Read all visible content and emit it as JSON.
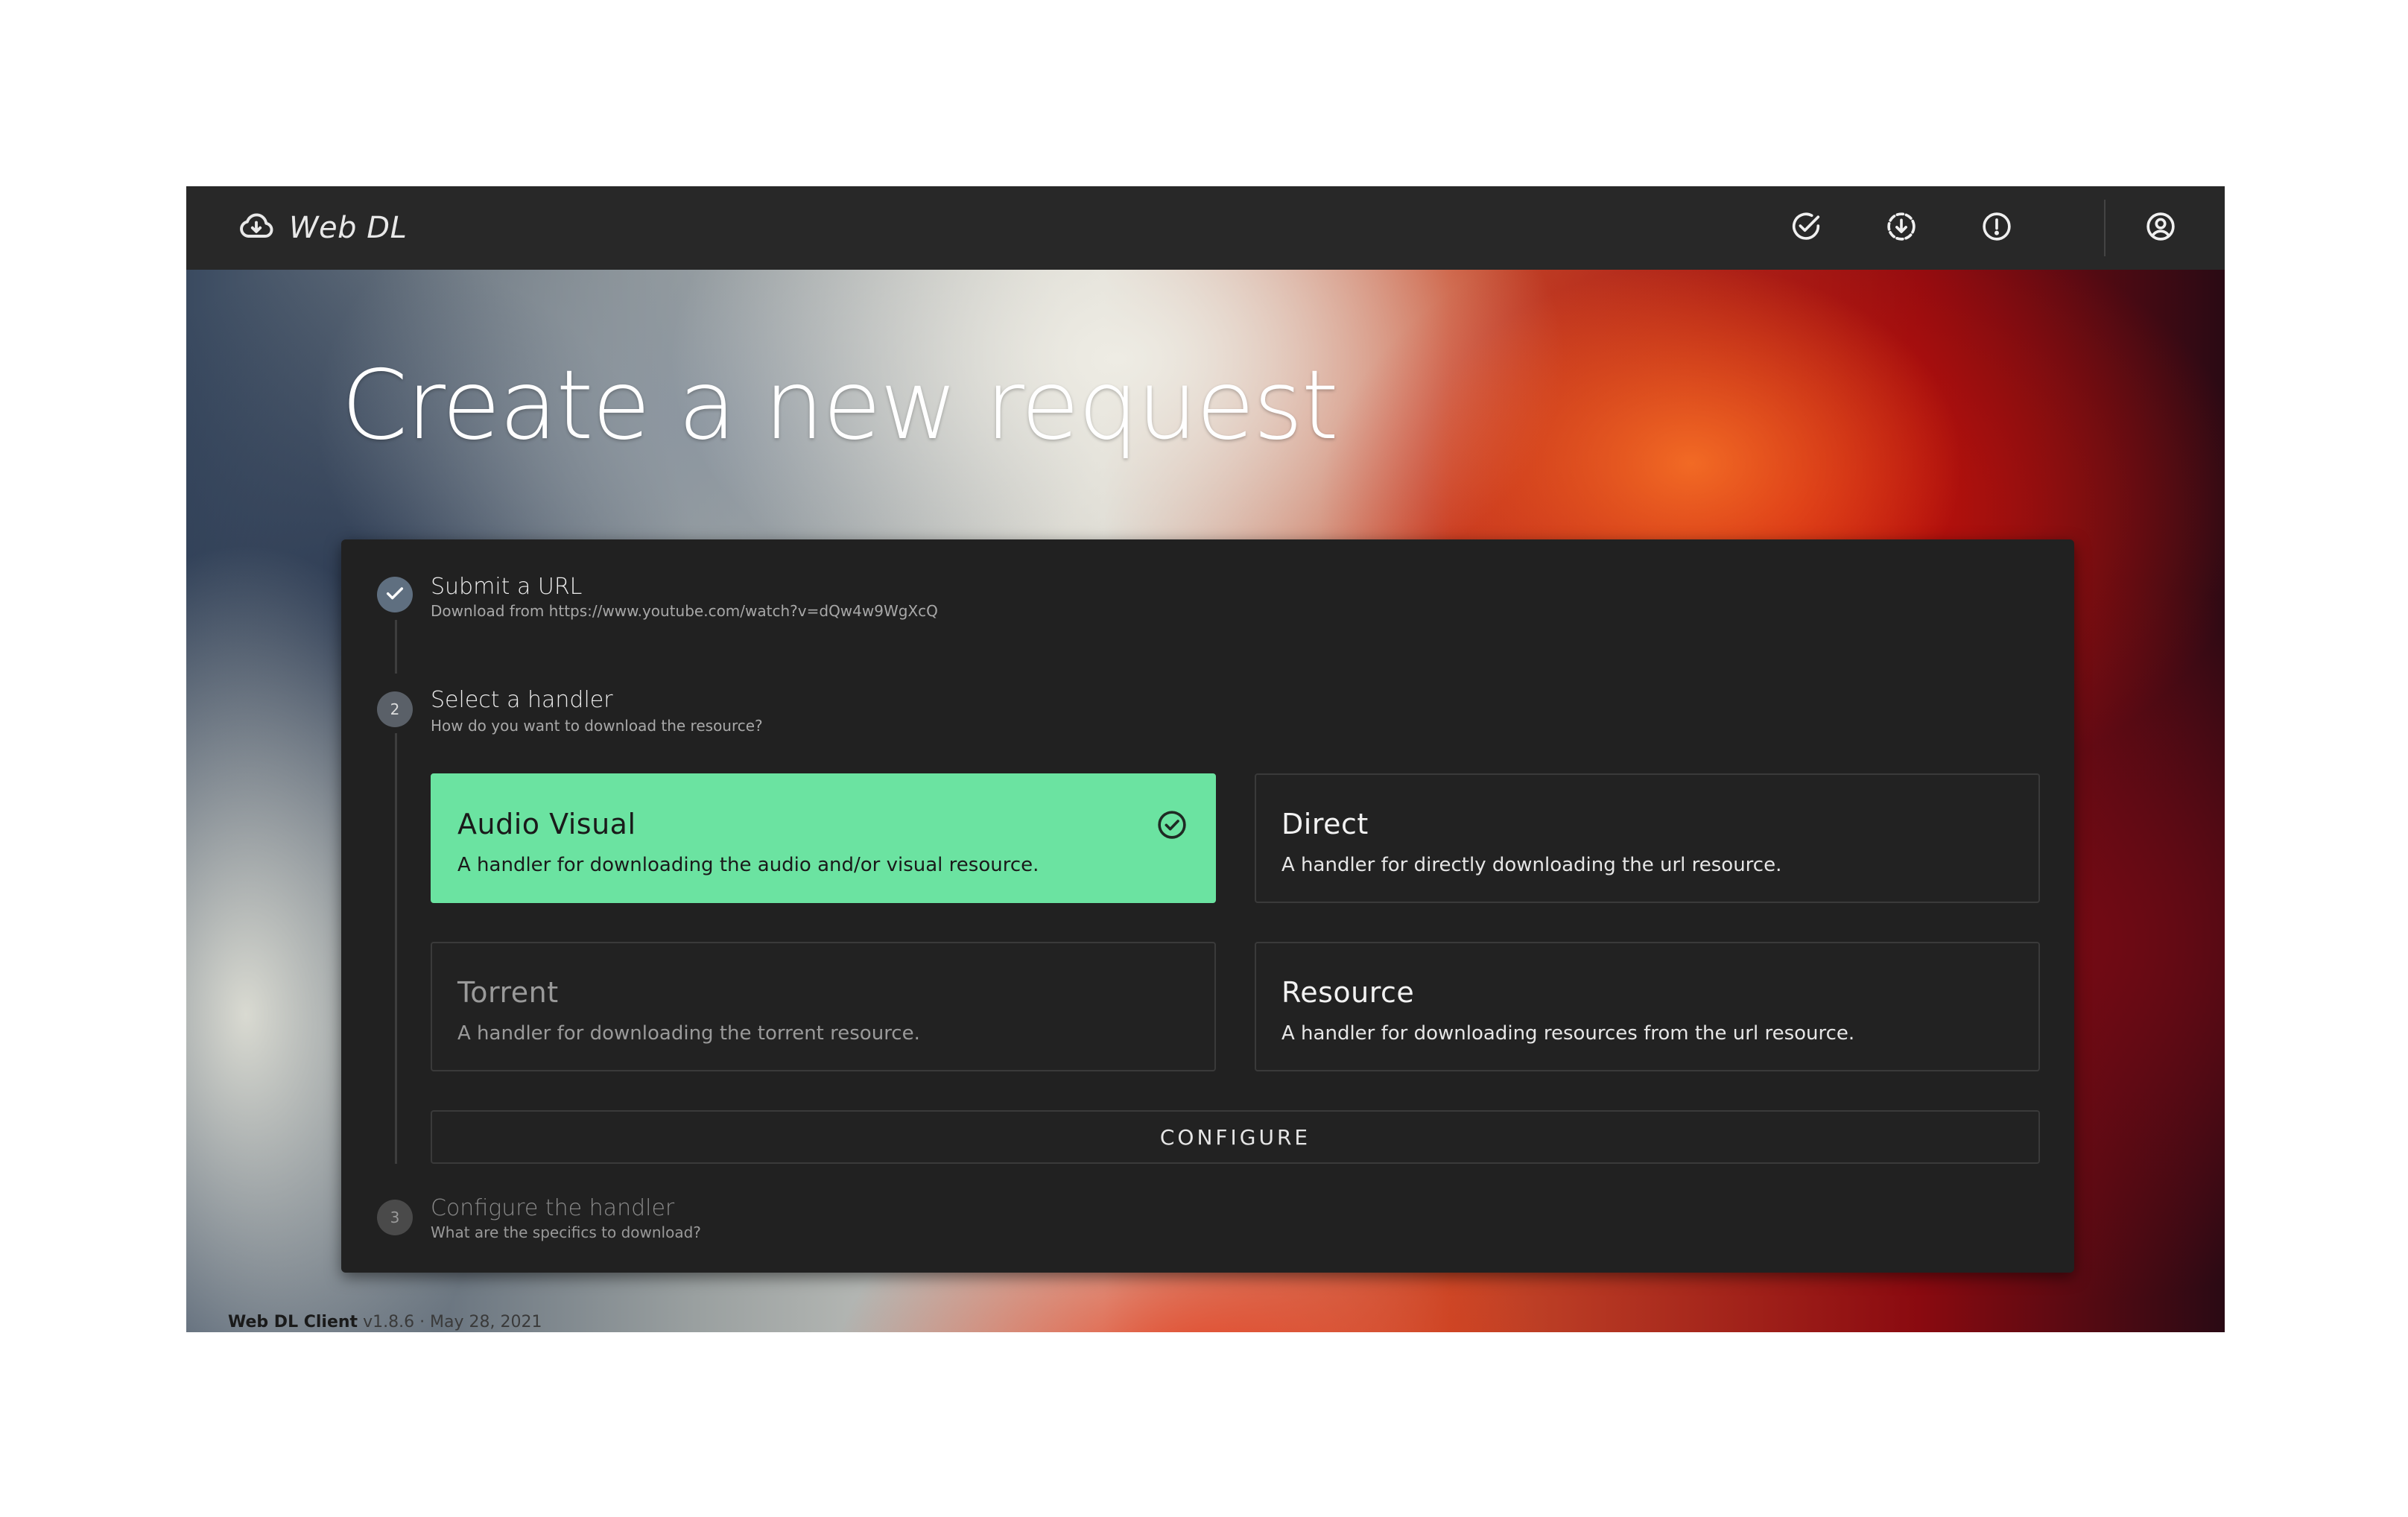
{
  "app": {
    "name": "Web DL",
    "icons": [
      "cloud-download-icon",
      "check-circle-icon",
      "download-progress-icon",
      "alert-circle-icon",
      "account-circle-icon"
    ]
  },
  "page": {
    "title": "Create a new request"
  },
  "steps": [
    {
      "number": "",
      "status": "complete",
      "title": "Submit a URL",
      "subtitle": "Download from https://www.youtube.com/watch?v=dQw4w9WgXcQ"
    },
    {
      "number": "2",
      "status": "active",
      "title": "Select a handler",
      "subtitle": "How do you want to download the resource?"
    },
    {
      "number": "3",
      "status": "pending",
      "title": "Configure the handler",
      "subtitle": "What are the specifics to download?"
    }
  ],
  "handlers": [
    {
      "name": "Audio Visual",
      "description": "A handler for downloading the audio and/or visual resource.",
      "state": "selected"
    },
    {
      "name": "Direct",
      "description": "A handler for directly downloading the url resource.",
      "state": "available"
    },
    {
      "name": "Torrent",
      "description": "A handler for downloading the torrent resource.",
      "state": "disabled"
    },
    {
      "name": "Resource",
      "description": "A handler for downloading resources from the url resource.",
      "state": "available"
    }
  ],
  "configure_label": "CONFIGURE",
  "footer": {
    "client_name": "Web DL Client",
    "version": "v1.8.6 · May 28, 2021"
  },
  "colors": {
    "topbar": "#282828",
    "panel": "#212121",
    "selected": "#6be3a1",
    "step_complete": "#5f6f80",
    "step_pending": "#4a4a4a"
  }
}
